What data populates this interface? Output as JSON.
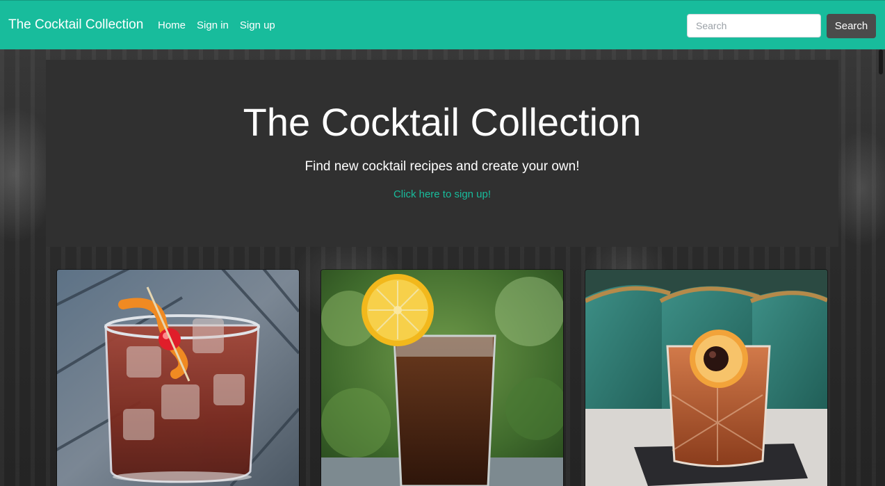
{
  "navbar": {
    "brand": "The Cocktail Collection",
    "links": [
      {
        "label": "Home"
      },
      {
        "label": "Sign in"
      },
      {
        "label": "Sign up"
      }
    ],
    "search": {
      "placeholder": "Search",
      "value": "",
      "button_label": "Search"
    }
  },
  "jumbotron": {
    "title": "The Cocktail Collection",
    "subtitle": "Find new cocktail recipes and create your own!",
    "cta_link": "Click here to sign up!"
  },
  "colors": {
    "navbar": "#18bc9c",
    "accent_link": "#18bc9c",
    "jumbotron_bg": "#303030",
    "search_button": "#4b4b4b"
  },
  "cocktails": [
    {
      "image": "old-fashioned-cocktail-photo"
    },
    {
      "image": "long-drink-with-lemon-photo"
    },
    {
      "image": "orange-garnished-rocks-cocktail-photo"
    }
  ]
}
